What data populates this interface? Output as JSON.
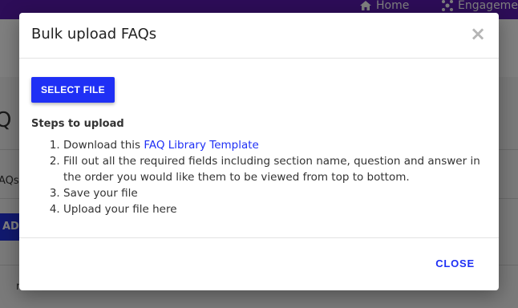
{
  "background": {
    "nav": {
      "home_label": "Home",
      "engagement_label": "Engageme"
    },
    "page_title_fragment": "Q L",
    "faqs_label_fragment": "AQs",
    "add_button_fragment": "AD",
    "row_text_fragment": "n"
  },
  "modal": {
    "title": "Bulk upload FAQs",
    "close_icon": "close-icon",
    "select_file_label": "SELECT FILE",
    "steps_title": "Steps to upload",
    "steps": {
      "step1_prefix": "Download this ",
      "step1_link": "FAQ Library Template",
      "step2": "Fill out all the required fields including section name, question and answer in the order you would like them to be viewed from top to bottom.",
      "step3": "Save your file",
      "step4": "Upload your file here"
    },
    "close_label": "CLOSE"
  },
  "colors": {
    "brand_topbar": "#5a1bb0",
    "accent_blue": "#1f30f5"
  }
}
